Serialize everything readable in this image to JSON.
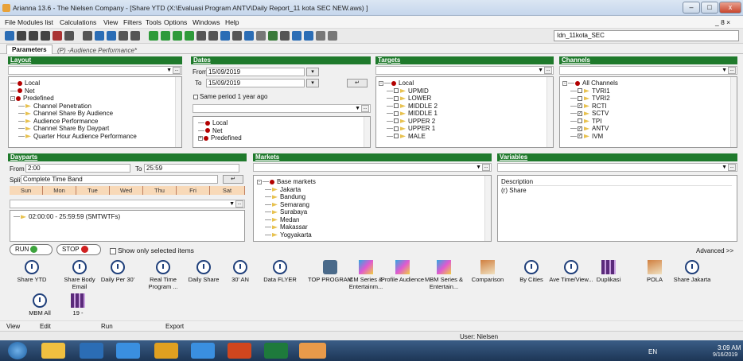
{
  "window": {
    "title": "Arianna 13.6 - The Nielsen Company - [Share YTD (X:\\Evaluasi Program ANTV\\Daily Report_11 kota SEC NEW.aws) ]",
    "min": "–",
    "max": "□",
    "close": "x"
  },
  "menu": [
    "File",
    "Modules list",
    "Calculations",
    "View",
    "Filters",
    "Tools",
    "Options",
    "Windows",
    "Help"
  ],
  "menu_right": "_ 8 ×",
  "toolbar": {
    "combo_value": "Idn_11kota_SEC"
  },
  "tabs": [
    "Parameters",
    "(P) -Audience Performance*"
  ],
  "layout": {
    "header": "Layout",
    "items": [
      "Local",
      "Net",
      "Predefined",
      "Channel Penetration",
      "Channel Share By Audience",
      "Audience Performance",
      "Channel Share By Daypart",
      "Quarter Hour Audience Performance"
    ]
  },
  "dates": {
    "header": "Dates",
    "from_label": "From",
    "from_value": "15/09/2019",
    "to_label": "To",
    "to_value": "15/09/2019",
    "same_period": "Same period 1 year ago",
    "items": [
      "Local",
      "Net",
      "Predefined"
    ]
  },
  "targets": {
    "header": "Targets",
    "items": [
      "Local",
      "UPMID",
      "LOWER",
      "MIDDLE 2",
      "MIDDLE 1",
      "UPPER 2",
      "UPPER 1",
      "MALE"
    ]
  },
  "channels": {
    "header": "Channels",
    "items": [
      "All Channels",
      "TVRI1",
      "TVRI2",
      "RCTI",
      "SCTV",
      "TPI",
      "ANTV",
      "IVM"
    ]
  },
  "dayparts": {
    "header": "Dayparts",
    "from_label": "From",
    "from_value": "2:00",
    "to_label": "To",
    "to_value": "25:59",
    "split_label": "Split",
    "split_value": "Complete Time Band",
    "days": [
      "Sun",
      "Mon",
      "Tue",
      "Wed",
      "Thu",
      "Fri",
      "Sat"
    ],
    "entry": "02:00:00 - 25:59:59 (SMTWTFs)"
  },
  "markets": {
    "header": "Markets",
    "items": [
      "Base markets",
      "Jakarta",
      "Bandung",
      "Semarang",
      "Surabaya",
      "Medan",
      "Makassar",
      "Yogyakarta"
    ]
  },
  "variables": {
    "header": "Variables",
    "desc_header": "Description",
    "item": "(r) Share"
  },
  "run": {
    "run_label": "RUN",
    "stop_label": "STOP",
    "show_only": "Show only selected items",
    "advanced": "Advanced >>"
  },
  "quick": [
    {
      "label": "Share YTD",
      "icon": "clock-icon"
    },
    {
      "label": "Share Body Email",
      "icon": "clock-icon"
    },
    {
      "label": "Daily Per 30'",
      "icon": "clock-icon"
    },
    {
      "label": "Real Time Program ...",
      "icon": "clock-icon"
    },
    {
      "label": "Daily Share",
      "icon": "clock-icon"
    },
    {
      "label": "30' AN",
      "icon": "clock-icon"
    },
    {
      "label": "Data FLYER",
      "icon": "clock-icon"
    },
    {
      "label": "TOP PROGRAM",
      "icon": "tool-icon"
    },
    {
      "label": "CM Series & Entertainm...",
      "icon": "chart-icon"
    },
    {
      "label": "Profile Audience",
      "icon": "chart-icon"
    },
    {
      "label": "MBM Series & Entertain...",
      "icon": "chart-icon"
    },
    {
      "label": "Comparison",
      "icon": "bars-icon"
    },
    {
      "label": "By Cities",
      "icon": "clock-icon"
    },
    {
      "label": "Ave Time/View...",
      "icon": "clock-icon"
    },
    {
      "label": "Duplikasi",
      "icon": "grid-icon"
    },
    {
      "label": "POLA",
      "icon": "bars-icon"
    },
    {
      "label": "Share Jakarta",
      "icon": "clock-icon"
    },
    {
      "label": "MBM All",
      "icon": "clock-icon"
    },
    {
      "label": "19 -",
      "icon": "grid-icon"
    }
  ],
  "bottombar": [
    "View",
    "Edit",
    "Run",
    "Export"
  ],
  "status": {
    "user": "User: Nielsen"
  },
  "taskbar": {
    "lang": "EN",
    "time": "3:09 AM",
    "date": "9/16/2019"
  }
}
